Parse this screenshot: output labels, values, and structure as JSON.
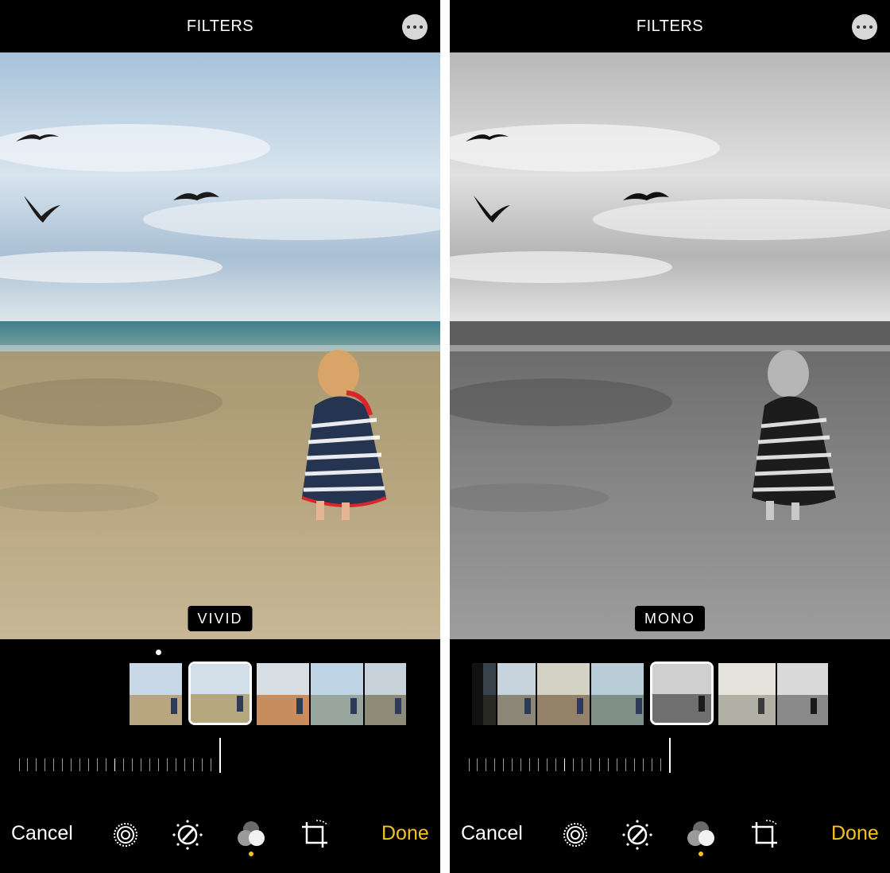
{
  "screens": [
    {
      "id": "left",
      "header": {
        "title": "FILTERS"
      },
      "filter_name": "VIVID",
      "photo_mode": "color",
      "toolbar": {
        "cancel_label": "Cancel",
        "done_label": "Done"
      },
      "icons": [
        "live-icon",
        "adjust-icon",
        "filters-icon",
        "crop-rotate-icon",
        "more-icon"
      ]
    },
    {
      "id": "right",
      "header": {
        "title": "FILTERS"
      },
      "filter_name": "MONO",
      "photo_mode": "grayscale",
      "toolbar": {
        "cancel_label": "Cancel",
        "done_label": "Done"
      },
      "icons": [
        "live-icon",
        "adjust-icon",
        "filters-icon",
        "crop-rotate-icon",
        "more-icon"
      ]
    }
  ],
  "colors": {
    "accent": "#f3c220",
    "background": "#000000",
    "text": "#ffffff"
  }
}
